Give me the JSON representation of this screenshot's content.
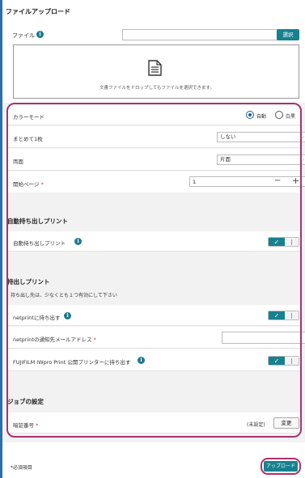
{
  "page": {
    "title": "ファイルアップロード"
  },
  "file": {
    "label": "ファイル",
    "select_button": "選択",
    "drop_hint": "文書ファイルをドロップしてもファイルを選択できます。"
  },
  "settings": {
    "color_mode": {
      "label": "カラーモード",
      "options": [
        "自動",
        "白黒"
      ],
      "selected": "自動"
    },
    "nup": {
      "label": "まとめて1枚",
      "value": "しない"
    },
    "duplex": {
      "label": "両面",
      "value": "片面"
    },
    "start_page": {
      "label": "開始ページ",
      "required": "*",
      "value": "1"
    }
  },
  "auto_carry": {
    "section_title": "自動持ち出しプリント",
    "label": "自動持ち出しプリント"
  },
  "carry": {
    "section_title": "持出しプリント",
    "note": "持ち出し先は、少なくとも１つ有効にして下さい",
    "netprint": {
      "label": "netprintに持ち出す"
    },
    "email": {
      "label": "netprintの通知先メールアドレス",
      "required": "*",
      "value": ""
    },
    "fujifilm": {
      "label": "FUJIFILM IWpro Print 公開プリンターに持ち出す"
    }
  },
  "job": {
    "section_title": "ジョブの設定",
    "pin": {
      "label": "暗証番号",
      "required": "*",
      "status": "(未設定)",
      "change_button": "変更"
    }
  },
  "footer": {
    "required_note": "*必須項目",
    "upload_button": "アップロード"
  },
  "colors": {
    "accent": "#17818f",
    "highlight": "#a8326c",
    "radio": "#1f5fa8"
  }
}
